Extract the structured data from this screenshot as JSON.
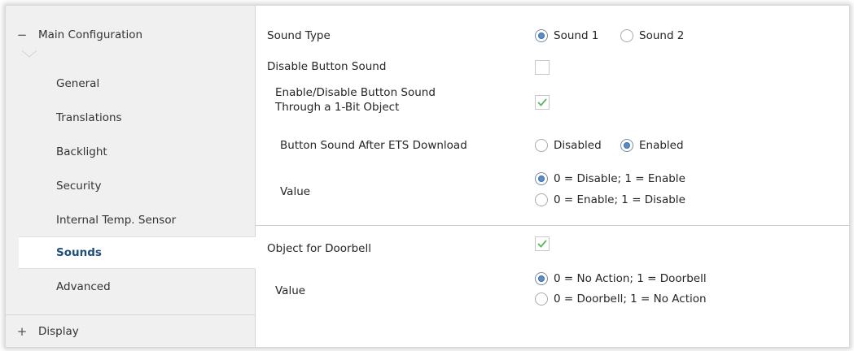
{
  "sidebar": {
    "main_group": {
      "toggle": "−",
      "label": "Main Configuration"
    },
    "items": [
      {
        "label": "General"
      },
      {
        "label": "Translations"
      },
      {
        "label": "Backlight"
      },
      {
        "label": "Security"
      },
      {
        "label": "Internal Temp. Sensor"
      },
      {
        "label": "Sounds",
        "active": true
      },
      {
        "label": "Advanced"
      }
    ],
    "display_group": {
      "toggle": "+",
      "label": "Display"
    }
  },
  "params": {
    "sound_type": {
      "label": "Sound Type",
      "options": [
        "Sound 1",
        "Sound 2"
      ],
      "selected": "Sound 1"
    },
    "disable_button_sound": {
      "label": "Disable Button Sound",
      "checked": false
    },
    "enable_disable_object": {
      "label_line1": "Enable/Disable Button Sound",
      "label_line2": "Through a 1-Bit Object",
      "checked": true
    },
    "after_download": {
      "label": "Button Sound After ETS Download",
      "options": [
        "Disabled",
        "Enabled"
      ],
      "selected": "Enabled"
    },
    "value1": {
      "label": "Value",
      "options": [
        "0 = Disable; 1 = Enable",
        "0 = Enable; 1 = Disable"
      ],
      "selected": "0 = Disable; 1 = Enable"
    },
    "doorbell_object": {
      "label": "Object for Doorbell",
      "checked": true
    },
    "value2": {
      "label": "Value",
      "options": [
        "0 = No Action; 1 = Doorbell",
        "0 = Doorbell; 1 = No Action"
      ],
      "selected": "0 = No Action; 1 = Doorbell"
    }
  },
  "colors": {
    "active_nav_text": "#1f4e79",
    "radio_selected": "#5b8cc6",
    "checkmark": "#5cb85c"
  }
}
